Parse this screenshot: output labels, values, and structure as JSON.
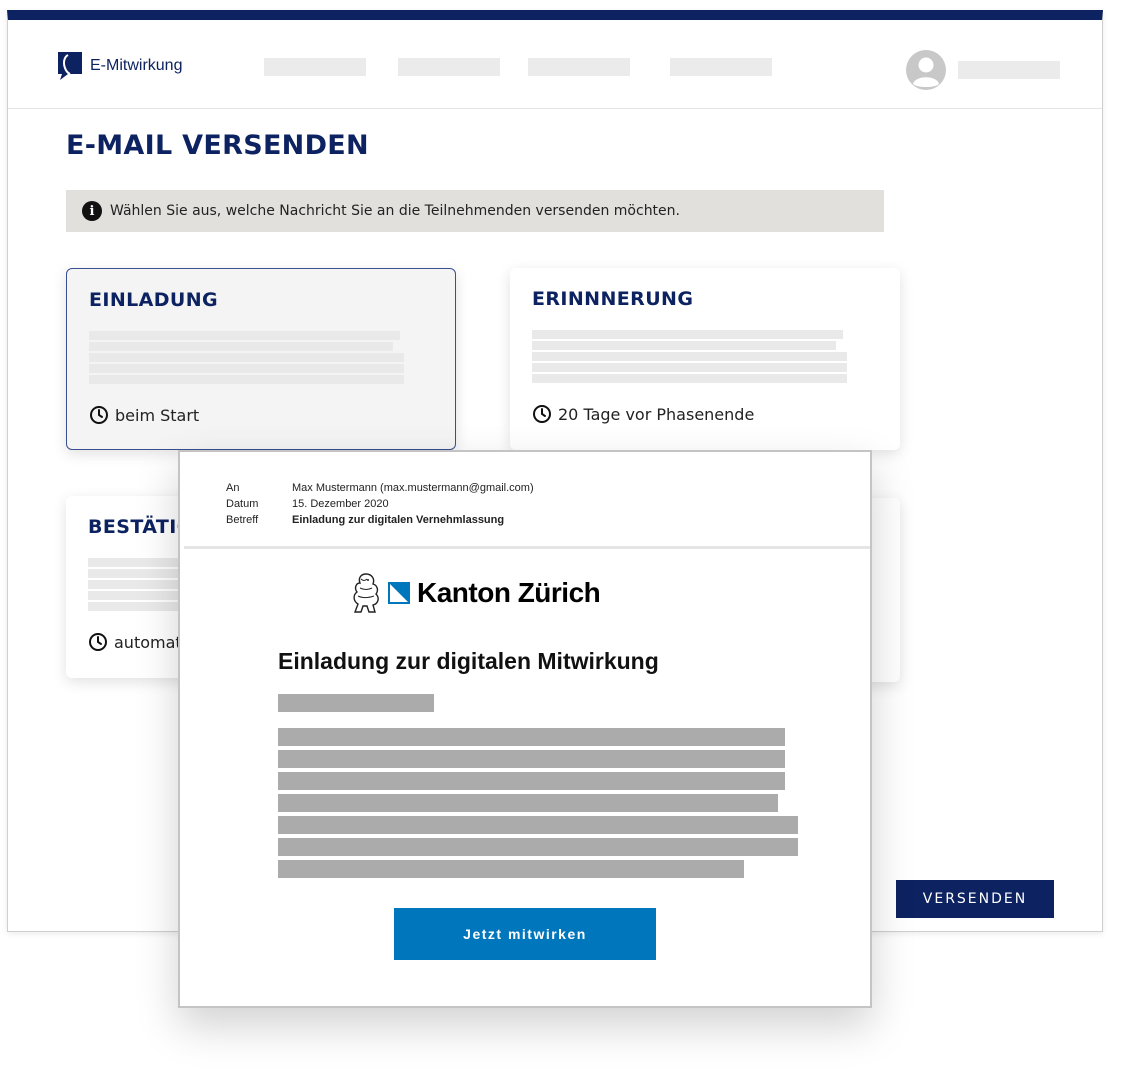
{
  "app": {
    "name": "E-Mitwirkung"
  },
  "page": {
    "title": "E-MAIL VERSENDEN",
    "info": "Wählen Sie aus, welche Nachricht Sie an die Teilnehmenden versenden möchten."
  },
  "cards": [
    {
      "title": "EINLADUNG",
      "timing": "beim Start"
    },
    {
      "title": "ERINNNERUNG",
      "timing": "20 Tage vor Phasenende"
    },
    {
      "title": "BESTÄTIGUNG",
      "timing": "automatisch"
    }
  ],
  "actions": {
    "send": "VERSENDEN"
  },
  "email": {
    "meta": {
      "to_label": "An",
      "to_value": "Max Mustermann (max.mustermann@gmail.com)",
      "date_label": "Datum",
      "date_value": "15. Dezember 2020",
      "subject_label": "Betreff",
      "subject_value": "Einladung zur digitalen Vernehmlassung"
    },
    "brand": "Kanton Zürich",
    "heading": "Einladung zur digitalen Mitwirkung",
    "cta": "Jetzt mitwirken"
  },
  "colors": {
    "primary": "#0d2260",
    "accent": "#0076bd",
    "banner": "#e2e0dd"
  }
}
